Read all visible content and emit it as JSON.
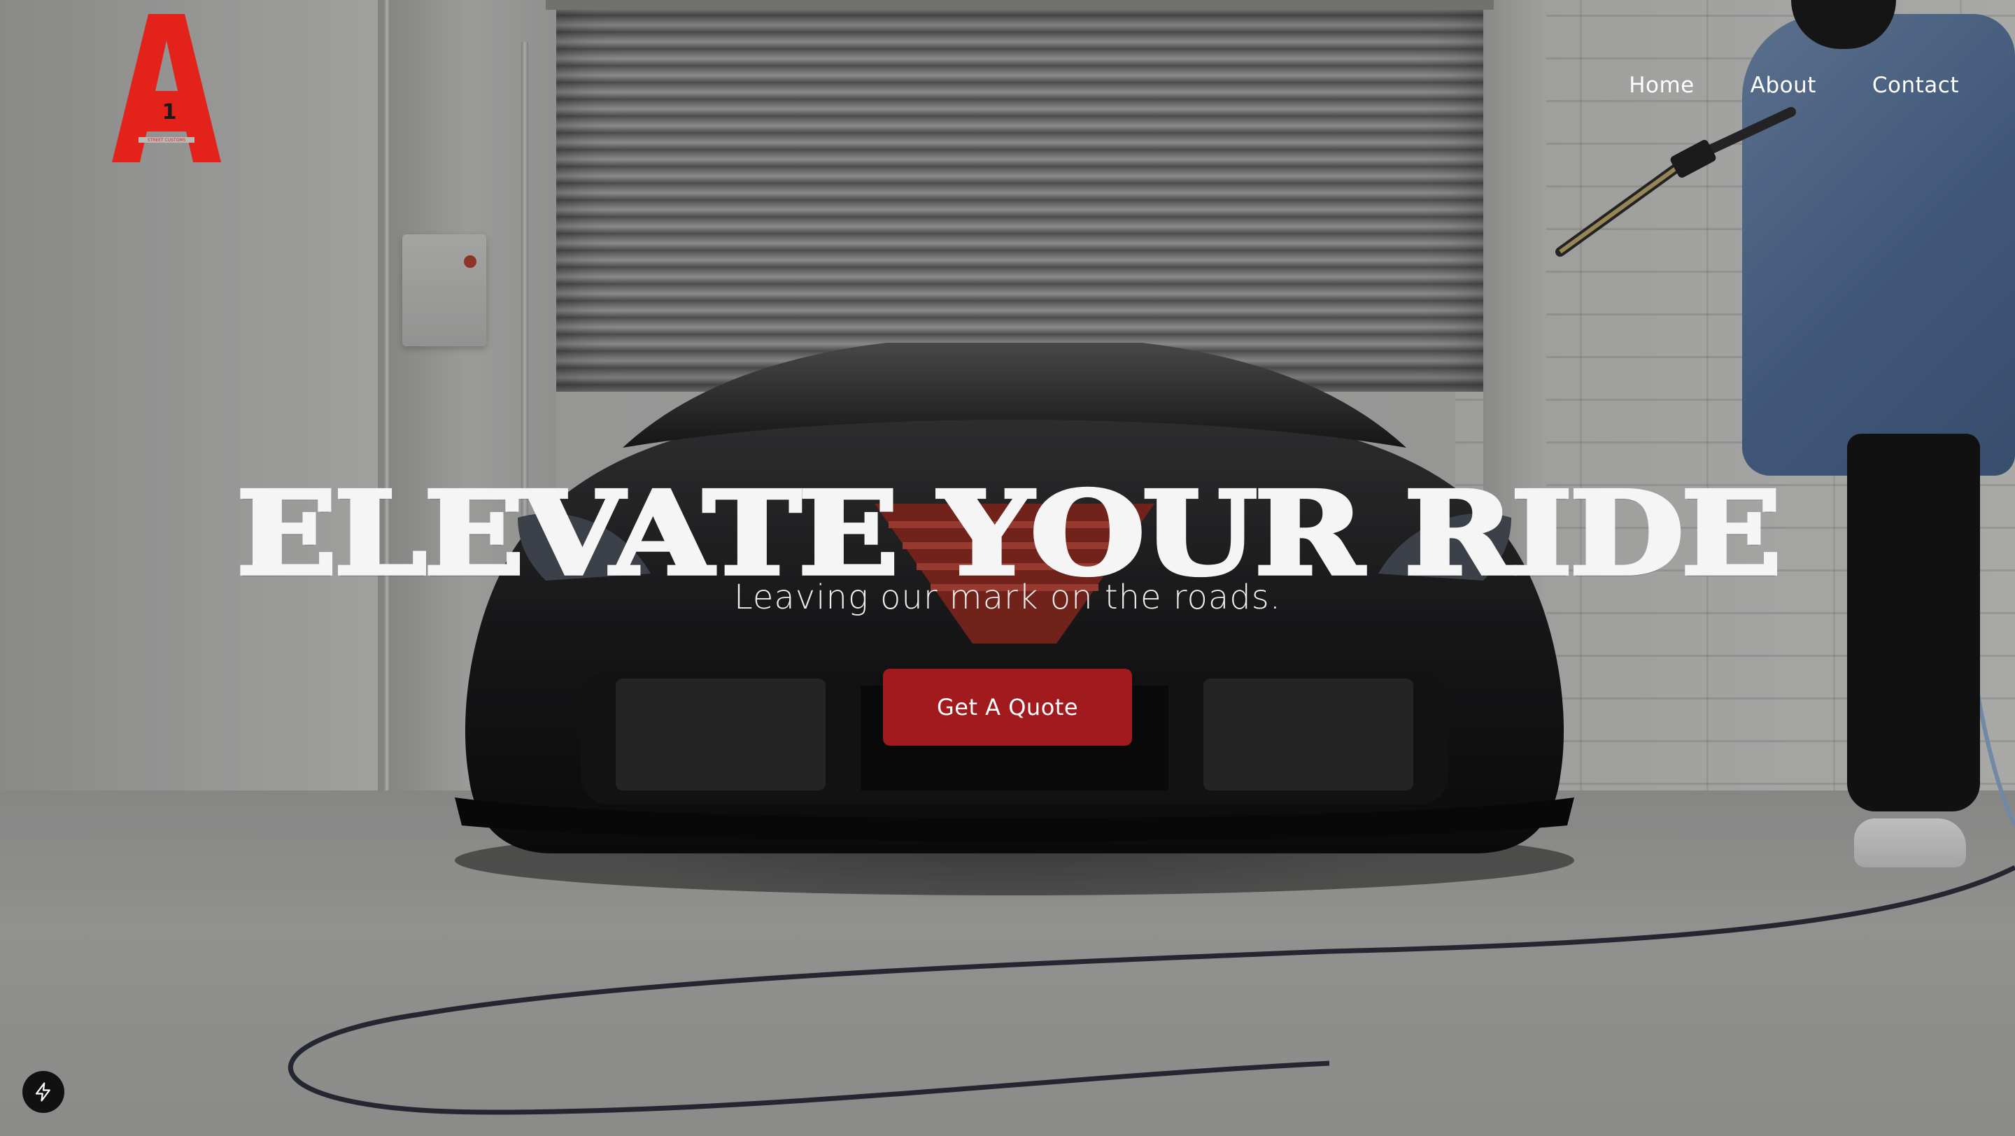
{
  "brand": {
    "logo_letter": "A",
    "logo_number": "1",
    "logo_subtext": "STREET CUSTOMS",
    "logo_color": "#e3231b"
  },
  "nav": {
    "items": [
      {
        "label": "Home"
      },
      {
        "label": "About"
      },
      {
        "label": "Contact"
      }
    ]
  },
  "hero": {
    "title": "ELEVATE YOUR RIDE",
    "subtitle": "Leaving our mark on the roads.",
    "cta_label": "Get A Quote",
    "cta_color": "#a11a1d"
  },
  "dev_badge": {
    "icon": "lightning-bolt-icon"
  }
}
